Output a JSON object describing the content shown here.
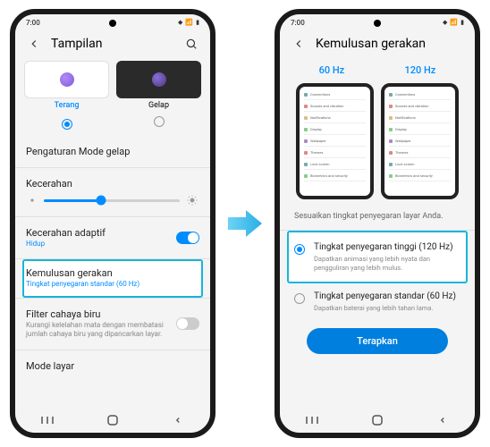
{
  "status_time": "7:00",
  "phone1": {
    "title": "Tampilan",
    "theme_light": "Terang",
    "theme_dark": "Gelap",
    "dark_mode_settings": "Pengaturan Mode gelap",
    "brightness": "Kecerahan",
    "adaptive_brightness": "Kecerahan adaptif",
    "adaptive_brightness_sub": "Hidup",
    "motion_smoothness": "Kemulusan gerakan",
    "motion_smoothness_sub": "Tingkat penyegaran standar (60 Hz)",
    "blue_light": "Filter cahaya biru",
    "blue_light_sub": "Kurangi kelelahan mata dengan membatasi jumlah cahaya biru yang dipancarkan layar.",
    "screen_mode": "Mode layar"
  },
  "phone2": {
    "title": "Kemulusan gerakan",
    "tab_60": "60 Hz",
    "tab_120": "120 Hz",
    "mini_items": [
      "Connections",
      "Sounds and vibration",
      "Notifications",
      "Display",
      "Wallpaper",
      "Themes",
      "Lock screen",
      "Biometrics and security"
    ],
    "desc": "Sesuaikan tingkat penyegaran layar Anda.",
    "option_high": "Tingkat penyegaran tinggi (120 Hz)",
    "option_high_sub": "Dapatkan animasi yang lebih nyata dan pengguliran yang lebih mulus.",
    "option_std": "Tingkat penyegaran standar (60 Hz)",
    "option_std_sub": "Dapatkan baterai yang lebih tahan lama.",
    "apply": "Terapkan"
  }
}
